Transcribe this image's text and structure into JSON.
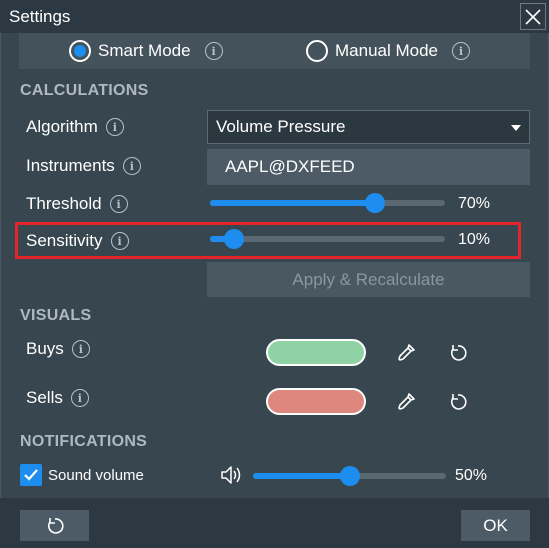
{
  "window": {
    "title": "Settings"
  },
  "modes": {
    "smart_label": "Smart Mode",
    "manual_label": "Manual Mode",
    "selected": "smart"
  },
  "calculations": {
    "heading": "CALCULATIONS",
    "algorithm_label": "Algorithm",
    "algorithm_value": "Volume Pressure",
    "instruments_label": "Instruments",
    "instruments_value": "AAPL@DXFEED",
    "threshold_label": "Threshold",
    "threshold_value": 70,
    "threshold_text": "70%",
    "sensitivity_label": "Sensitivity",
    "sensitivity_value": 10,
    "sensitivity_text": "10%",
    "apply_label": "Apply & Recalculate"
  },
  "visuals": {
    "heading": "VISUALS",
    "buys_label": "Buys",
    "buys_color": "#8fd3a4",
    "sells_label": "Sells",
    "sells_color": "#dd877f"
  },
  "notifications": {
    "heading": "NOTIFICATIONS",
    "sound_label": "Sound volume",
    "sound_checked": true,
    "volume_value": 50,
    "volume_text": "50%"
  },
  "footer": {
    "ok_label": "OK"
  },
  "colors": {
    "accent": "#1d8ef0",
    "highlight": "#e3242b"
  },
  "icons": [
    "close-icon",
    "info-icon",
    "caret-down-icon",
    "eyedropper-icon",
    "reset-icon",
    "speaker-icon",
    "checkmark-icon"
  ]
}
